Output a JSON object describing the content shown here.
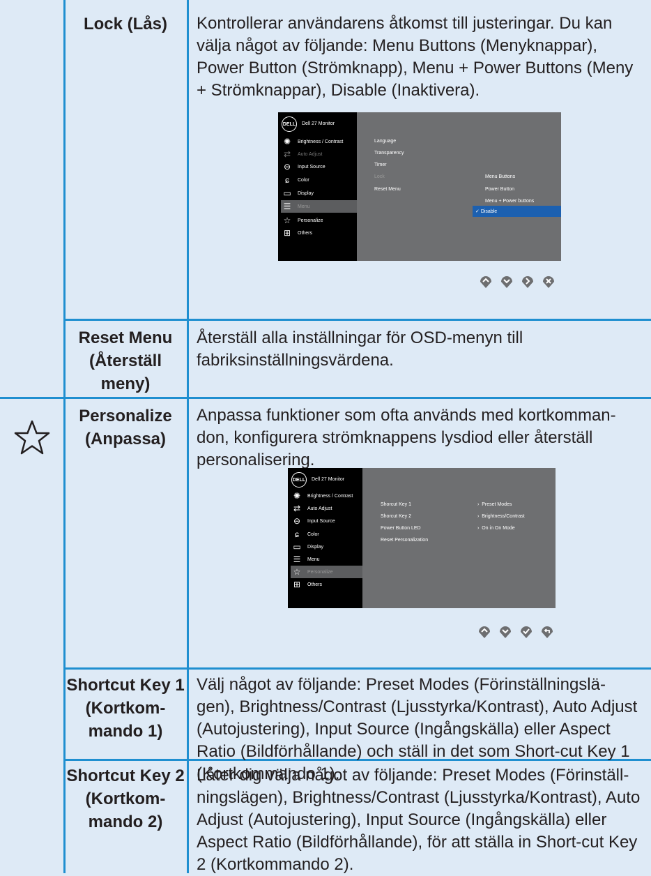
{
  "rows": [
    {
      "label": "Lock (Lås)",
      "desc": "Kontrollerar användarens åtkomst till justeringar. Du kan välja något av följande: Menu Buttons (Menyknappar), Power Button (Strömknapp), Menu + Power Buttons (Meny + Strömknappar), Disable (Inaktivera)."
    },
    {
      "label": "Reset Menu (Återställ meny)",
      "desc": "Återställ alla inställningar för OSD-menyn till fabriksinställningsvärdena."
    },
    {
      "label": "Personalize (Anpassa)",
      "desc": "Anpassa funktioner som ofta används med kortkomman-don, konfigurera strömknappens lysdiod eller återställ personalisering."
    },
    {
      "label": "Shortcut Key 1 (Kortkom-mando 1)",
      "desc": "Välj något av följande: Preset Modes (Förinställningslä-gen), Brightness/Contrast (Ljusstyrka/Kontrast), Auto Adjust (Autojustering), Input Source (Ingångskälla) eller Aspect Ratio (Bildförhållande) och ställ in det som Short-cut Key 1 (Kortkommando 1)."
    },
    {
      "label": "Shortcut Key 2 (Kortkom-mando 2)",
      "desc": "Låter dig välja något av följande: Preset Modes (Förinställ-ningslägen), Brightness/Contrast (Ljusstyrka/Kontrast), Auto Adjust (Autojustering), Input Source (Ingångskälla) eller Aspect Ratio (Bildförhållande), för att ställa in Short-cut Key 2 (Kortkommando 2)."
    }
  ],
  "osd1": {
    "logo": "DELL",
    "title": "Dell 27 Monitor",
    "side_items": [
      {
        "label": "Brightness / Contrast",
        "icon": "brightness-icon"
      },
      {
        "label": "Auto Adjust",
        "icon": "auto-adjust-icon"
      },
      {
        "label": "Input Source",
        "icon": "input-source-icon"
      },
      {
        "label": "Color",
        "icon": "color-icon"
      },
      {
        "label": "Display",
        "icon": "display-icon"
      },
      {
        "label": "Menu",
        "icon": "menu-icon"
      },
      {
        "label": "Personalize",
        "icon": "star-icon"
      },
      {
        "label": "Others",
        "icon": "others-icon"
      }
    ],
    "menu_items": [
      "Language",
      "Transparency",
      "Timer",
      "Lock",
      "Reset Menu"
    ],
    "sub_items": [
      "Menu Buttons",
      "Power Button",
      "Menu + Power buttons",
      "Disable"
    ],
    "selected_sub": "Disable"
  },
  "osd2": {
    "logo": "DELL",
    "title": "Dell 27 Monitor",
    "side_items": [
      {
        "label": "Brightness / Contrast",
        "icon": "brightness-icon"
      },
      {
        "label": "Auto Adjust",
        "icon": "auto-adjust-icon"
      },
      {
        "label": "Input Source",
        "icon": "input-source-icon"
      },
      {
        "label": "Color",
        "icon": "color-icon"
      },
      {
        "label": "Display",
        "icon": "display-icon"
      },
      {
        "label": "Menu",
        "icon": "menu-icon"
      },
      {
        "label": "Personalize",
        "icon": "star-icon"
      },
      {
        "label": "Others",
        "icon": "others-icon"
      }
    ],
    "menu_items": [
      "Shorcut Key 1",
      "Shorcut Key 2",
      "Power Button LED",
      "Reset Personalization"
    ],
    "values": [
      "Preset Modes",
      "Brightness/Contrast",
      "On in On Mode"
    ]
  },
  "colors": {
    "background": "#deeaf6",
    "grid": "#1f8fd0",
    "highlight": "#1c60b0",
    "nav_button": "#6d6e70"
  }
}
